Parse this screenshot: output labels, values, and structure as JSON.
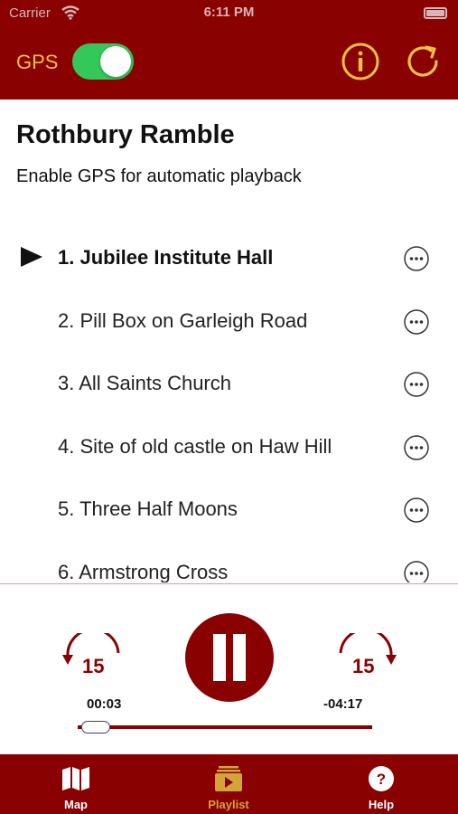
{
  "status_bar": {
    "carrier": "Carrier",
    "time": "6:11 PM"
  },
  "header": {
    "gps_label": "GPS",
    "gps_enabled": true,
    "accent": "#8a0101",
    "icon_color": "#f0c040"
  },
  "route": {
    "title": "Rothbury Ramble",
    "subtitle": "Enable GPS for automatic playback"
  },
  "playlist": [
    {
      "label": "1. Jubilee Institute Hall",
      "current": true
    },
    {
      "label": "2. Pill Box on Garleigh Road",
      "current": false
    },
    {
      "label": "3. All Saints Church",
      "current": false
    },
    {
      "label": "4. Site of old castle on Haw Hill",
      "current": false
    },
    {
      "label": "5. Three Half Moons",
      "current": false
    },
    {
      "label": "6. Armstrong Cross",
      "current": false
    }
  ],
  "player": {
    "skip_back_seconds": "15",
    "skip_forward_seconds": "15",
    "elapsed": "00:03",
    "remaining": "-04:17",
    "progress_fraction": 0.012,
    "state": "playing"
  },
  "tabs": [
    {
      "label": "Map",
      "icon": "map-icon",
      "active": false
    },
    {
      "label": "Playlist",
      "icon": "playlist-icon",
      "active": true
    },
    {
      "label": "Help",
      "icon": "help-icon",
      "active": false
    }
  ]
}
